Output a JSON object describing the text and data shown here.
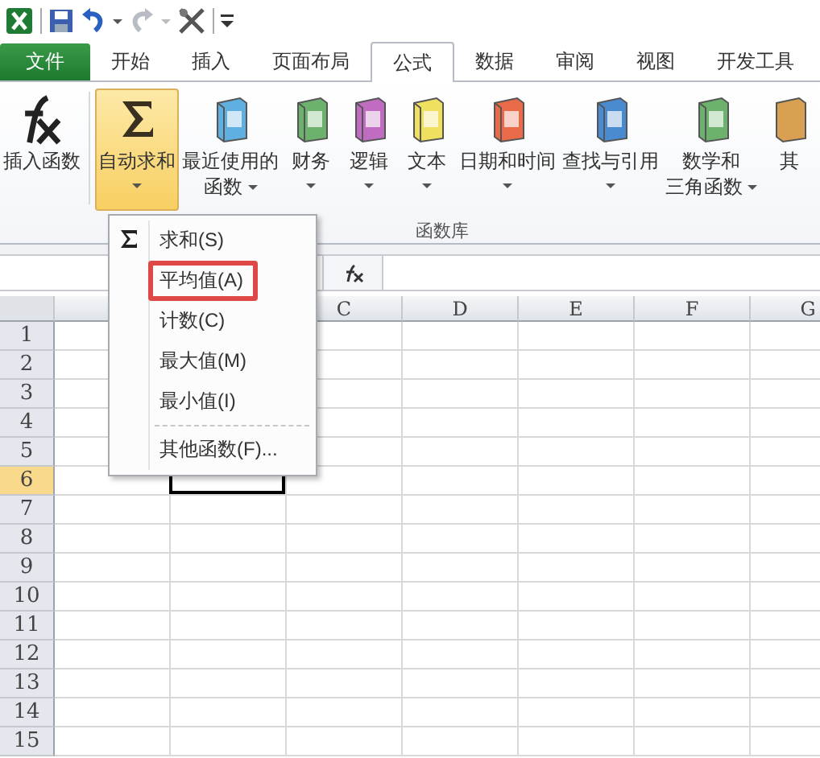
{
  "tabs": [
    {
      "label": "文件",
      "kind": "file",
      "selected": false
    },
    {
      "label": "开始",
      "kind": "tab",
      "selected": false
    },
    {
      "label": "插入",
      "kind": "tab",
      "selected": false
    },
    {
      "label": "页面布局",
      "kind": "tab",
      "selected": false
    },
    {
      "label": "公式",
      "kind": "tab",
      "selected": true
    },
    {
      "label": "数据",
      "kind": "tab",
      "selected": false
    },
    {
      "label": "审阅",
      "kind": "tab",
      "selected": false
    },
    {
      "label": "视图",
      "kind": "tab",
      "selected": false
    },
    {
      "label": "开发工具",
      "kind": "tab",
      "selected": false
    }
  ],
  "ribbon": {
    "group_label": "函数库",
    "buttons": [
      {
        "kind": "fx",
        "lines": [
          "插入函数"
        ],
        "dropdown": false,
        "selected": false
      },
      {
        "kind": "sigma",
        "lines": [
          "自动求和"
        ],
        "dropdown": true,
        "selected": true
      },
      {
        "kind": "book",
        "lines": [
          "最近使用的",
          "函数"
        ],
        "dropdown": true,
        "selected": false
      },
      {
        "kind": "book",
        "lines": [
          "财务"
        ],
        "dropdown": true,
        "selected": false
      },
      {
        "kind": "book",
        "lines": [
          "逻辑"
        ],
        "dropdown": true,
        "selected": false
      },
      {
        "kind": "book",
        "lines": [
          "文本"
        ],
        "dropdown": true,
        "selected": false
      },
      {
        "kind": "book",
        "lines": [
          "日期和时间"
        ],
        "dropdown": true,
        "selected": false
      },
      {
        "kind": "book",
        "lines": [
          "查找与引用"
        ],
        "dropdown": true,
        "selected": false
      },
      {
        "kind": "book",
        "lines": [
          "数学和",
          "三角函数"
        ],
        "dropdown": true,
        "selected": false
      },
      {
        "kind": "cut",
        "lines": [
          "其"
        ],
        "dropdown": false,
        "selected": false
      }
    ]
  },
  "menu": {
    "items": [
      {
        "label": "求和(S)",
        "annotated": false
      },
      {
        "label": "平均值(A)",
        "annotated": true
      },
      {
        "label": "计数(C)",
        "annotated": false
      },
      {
        "label": "最大值(M)",
        "annotated": false
      },
      {
        "label": "最小值(I)",
        "annotated": false
      },
      {
        "label": "其他函数(F)...",
        "annotated": false
      }
    ]
  },
  "columns": [
    "C",
    "D",
    "E",
    "F",
    "G"
  ],
  "rows": [
    {
      "label": "1",
      "selected": false
    },
    {
      "label": "2",
      "selected": false
    },
    {
      "label": "3",
      "selected": false
    },
    {
      "label": "4",
      "selected": false
    },
    {
      "label": "5",
      "selected": false
    },
    {
      "label": "6",
      "selected": true
    },
    {
      "label": "7",
      "selected": false
    },
    {
      "label": "8",
      "selected": false
    },
    {
      "label": "9",
      "selected": false
    },
    {
      "label": "10",
      "selected": false
    },
    {
      "label": "11",
      "selected": false
    },
    {
      "label": "12",
      "selected": false
    },
    {
      "label": "13",
      "selected": false
    },
    {
      "label": "14",
      "selected": false
    },
    {
      "label": "15",
      "selected": false
    }
  ]
}
